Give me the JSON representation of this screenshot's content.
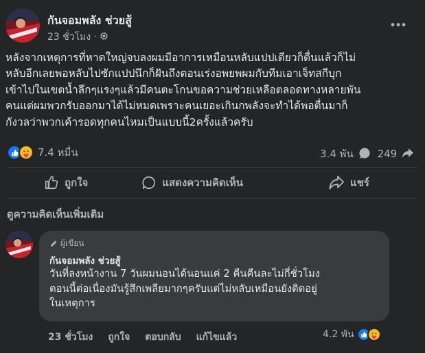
{
  "post": {
    "author": "กันจอมพลัง ช่วยสู้",
    "time": "23 ชั่วโมง",
    "privacy_icon": "gear-icon",
    "text_lines": [
      "หลังจากเหตุการที่หาดใหญ่จบลงผมมีอาการเหมือนหลับแปปเดียวก็ตื่นแล้วก็ไม่",
      "หลับอีกเลยพอหลับไปซักแปปนึกก็ฝันถึงตอนเร่งอพยพผมกับทีมเอาเจ็ทสกีบุก",
      "เข้าไปในเขตน้ำลึกๆแรงๆแล้วมีคนตะโกนขอความช่วยเหลือตลอดทางหลายพัน",
      "คนแต่ผมพวกรับออกมาได้ไม่หมดเพราะคนเยอะเกินกพลังจะทำได้พอตื่นมาก็",
      "กังวลว่าพวกเค้ารอดทุกคนไหมเป็นแบบนี้2ครั้งแล้วครับ"
    ],
    "reaction_count": "7.4 หมื่น",
    "comment_count": "3.4 พัน",
    "share_count": "249"
  },
  "actions": {
    "like": "ถูกใจ",
    "comment": "แสดงความคิดเห็น",
    "share": "แชร์"
  },
  "more_comments": "ดูความคิดเห็นเพิ่มเติม",
  "comment": {
    "badge": "ผู้เขียน",
    "author": "กันจอมพลัง ช่วยสู้",
    "text_lines": [
      "วันที่ลงหน้างาน 7 วันผมนอนได้นอนแค่ 2 คืนคืนละไม่กี่ชั่วโมง",
      "ตอนนี้ต่อเนื่องมันรู้สึกเพลียมากๆครับแต่ไม่หลับเหมือนยังติดอยู่",
      "ในเหตุการ"
    ],
    "time": "23 ชั่วโมง",
    "like": "ถูกใจ",
    "reply": "ตอบกลับ",
    "edited": "แก้ไขแล้ว",
    "reaction_count": "4.2 พัน"
  },
  "colors": {
    "background": "#242526",
    "bubble": "#3a3b3c",
    "text": "#e4e6eb",
    "muted": "#b0b3b8",
    "like_blue": "#1877f2",
    "care_yellow": "#f7b928"
  }
}
